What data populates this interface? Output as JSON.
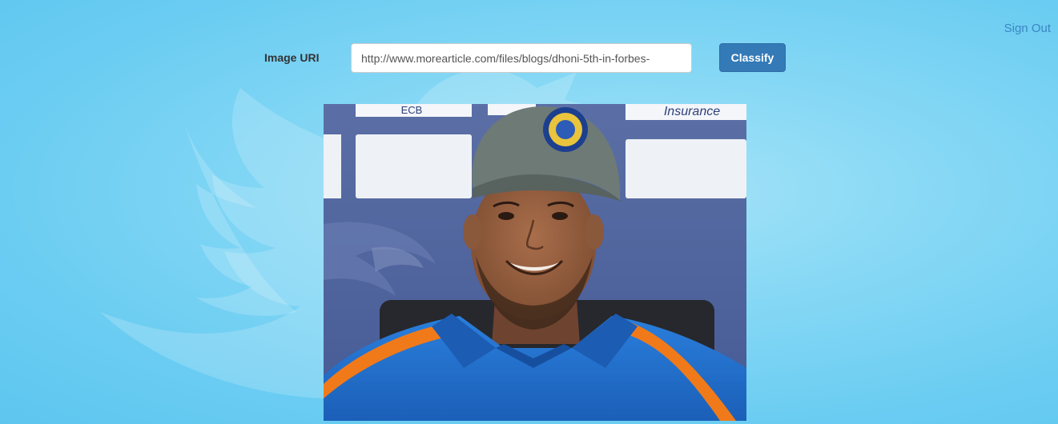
{
  "header": {
    "sign_out_label": "Sign Out"
  },
  "form": {
    "label": "Image URI",
    "uri_value": "http://www.morearticle.com/files/blogs/dhoni-5th-in-forbes-",
    "classify_label": "Classify"
  },
  "photo": {
    "banner_texts": [
      "ECB",
      "Insurance"
    ],
    "description": "Man in grey cricket cap and blue jersey at a press conference"
  },
  "background": {
    "decoration": "twitter-bird-icon"
  },
  "colors": {
    "background": "#6ccdf2",
    "link": "#3a87c0",
    "button": "#337ab7",
    "jersey": "#1e6fd0",
    "jersey_stripe": "#f07a1a",
    "cap": "#6e7a76"
  }
}
